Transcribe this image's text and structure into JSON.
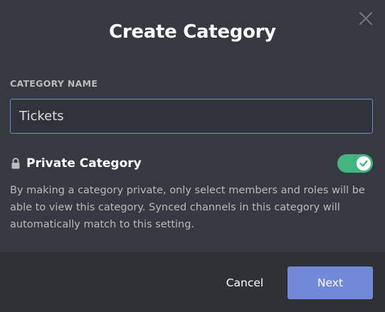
{
  "dialog": {
    "title": "Create Category",
    "close_icon": "close-icon"
  },
  "category_name": {
    "label": "CATEGORY NAME",
    "value": "Tickets"
  },
  "private_category": {
    "lock_icon": "lock-icon",
    "label": "Private Category",
    "enabled": true,
    "toggle_color": "#43b581",
    "description": "By making a category private, only select members and roles will be able to view this category. Synced channels in this category will automatically match to this setting."
  },
  "footer": {
    "cancel_label": "Cancel",
    "next_label": "Next",
    "next_color": "#7289da"
  },
  "colors": {
    "background": "#36393f",
    "footer_background": "#2f3136",
    "input_border": "#7289da"
  }
}
